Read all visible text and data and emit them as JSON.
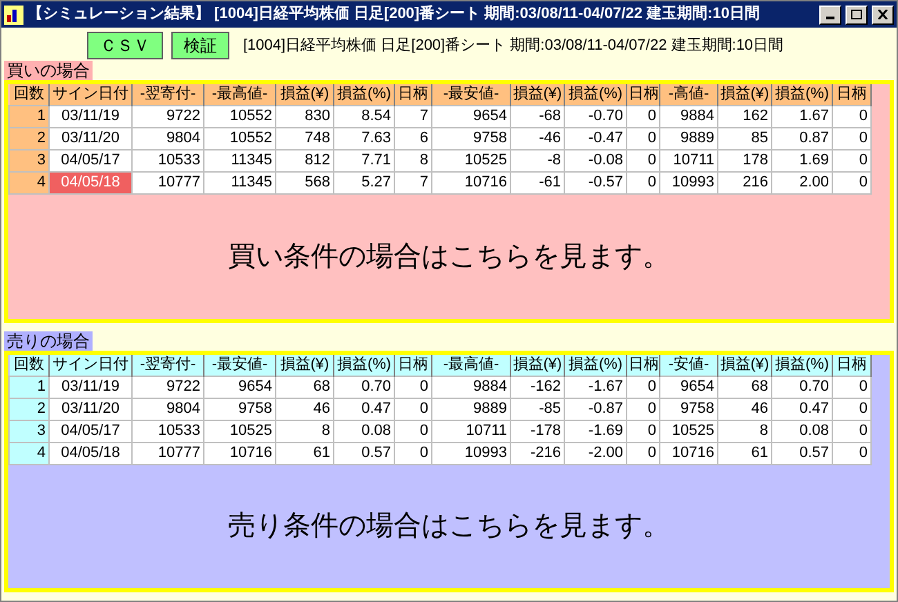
{
  "window": {
    "title": "【シミュレーション結果】 [1004]日経平均株価 日足[200]番シート  期間:03/08/11-04/07/22  建玉期間:10日間"
  },
  "toolbar": {
    "buttons": [
      "ＣＳＶ",
      "検証"
    ],
    "info": "[1004]日経平均株価 日足[200]番シート   期間:03/08/11-04/07/22   建玉期間:10日間"
  },
  "sections": [
    {
      "kind": "buy",
      "label": "買いの場合",
      "columns": [
        "回数",
        "サイン日付",
        "-翌寄付-",
        "-最高値-",
        "損益(¥)",
        "損益(%)",
        "日柄",
        "-最安値-",
        "損益(¥)",
        "損益(%)",
        "日柄",
        "-高値-",
        "損益(¥)",
        "損益(%)",
        "日柄"
      ],
      "rows": [
        {
          "highlighted": false,
          "cells": [
            "1",
            "03/11/19",
            "9722",
            "10552",
            "830",
            "8.54",
            "7",
            "9654",
            "-68",
            "-0.70",
            "0",
            "9884",
            "162",
            "1.67",
            "0"
          ]
        },
        {
          "highlighted": false,
          "cells": [
            "2",
            "03/11/20",
            "9804",
            "10552",
            "748",
            "7.63",
            "6",
            "9758",
            "-46",
            "-0.47",
            "0",
            "9889",
            "85",
            "0.87",
            "0"
          ]
        },
        {
          "highlighted": false,
          "cells": [
            "3",
            "04/05/17",
            "10533",
            "11345",
            "812",
            "7.71",
            "8",
            "10525",
            "-8",
            "-0.08",
            "0",
            "10711",
            "178",
            "1.69",
            "0"
          ]
        },
        {
          "highlighted": true,
          "cells": [
            "4",
            "04/05/18",
            "10777",
            "11345",
            "568",
            "5.27",
            "7",
            "10716",
            "-61",
            "-0.57",
            "0",
            "10993",
            "216",
            "2.00",
            "0"
          ]
        }
      ],
      "message": "買い条件の場合はこちらを見ます。"
    },
    {
      "kind": "sell",
      "label": "売りの場合",
      "columns": [
        "回数",
        "サイン日付",
        "-翌寄付-",
        "-最安値-",
        "損益(¥)",
        "損益(%)",
        "日柄",
        "-最高値-",
        "損益(¥)",
        "損益(%)",
        "日柄",
        "-安値-",
        "損益(¥)",
        "損益(%)",
        "日柄"
      ],
      "rows": [
        {
          "highlighted": false,
          "cells": [
            "1",
            "03/11/19",
            "9722",
            "9654",
            "68",
            "0.70",
            "0",
            "9884",
            "-162",
            "-1.67",
            "0",
            "9654",
            "68",
            "0.70",
            "0"
          ]
        },
        {
          "highlighted": false,
          "cells": [
            "2",
            "03/11/20",
            "9804",
            "9758",
            "46",
            "0.47",
            "0",
            "9889",
            "-85",
            "-0.87",
            "0",
            "9758",
            "46",
            "0.47",
            "0"
          ]
        },
        {
          "highlighted": false,
          "cells": [
            "3",
            "04/05/17",
            "10533",
            "10525",
            "8",
            "0.08",
            "0",
            "10711",
            "-178",
            "-1.69",
            "0",
            "10525",
            "8",
            "0.08",
            "0"
          ]
        },
        {
          "highlighted": false,
          "cells": [
            "4",
            "04/05/18",
            "10777",
            "10716",
            "61",
            "0.57",
            "0",
            "10993",
            "-216",
            "-2.00",
            "0",
            "10716",
            "61",
            "0.57",
            "0"
          ]
        }
      ],
      "message": "売り条件の場合はこちらを見ます。"
    }
  ]
}
